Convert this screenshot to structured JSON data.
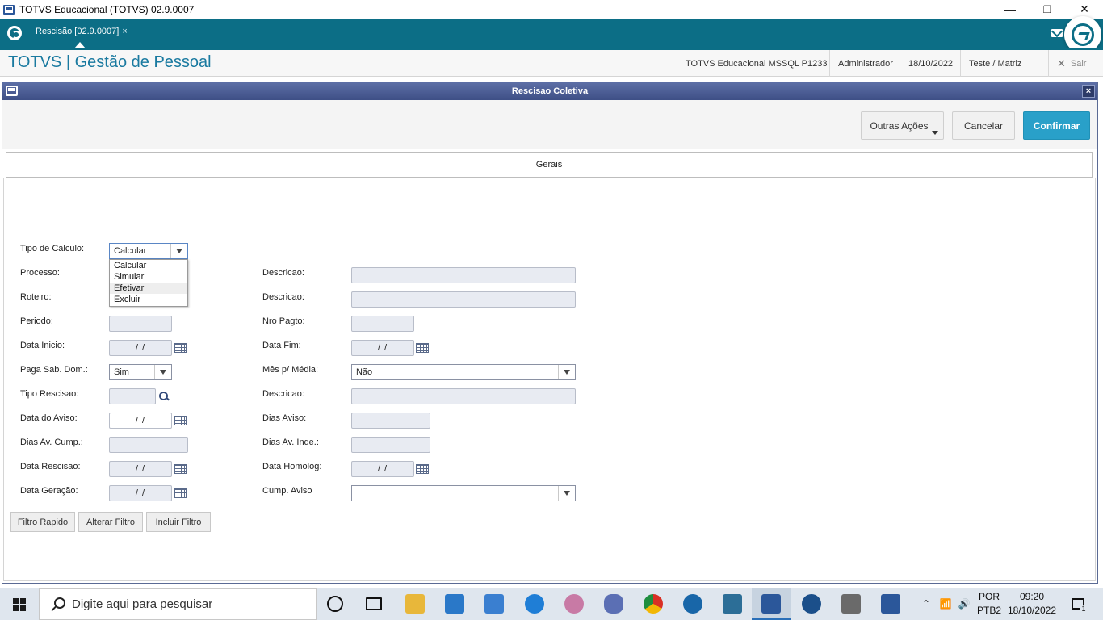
{
  "window": {
    "title": "TOTVS Educacional (TOTVS) 02.9.0007",
    "minimize": "—",
    "restore": "❐",
    "close": "✕"
  },
  "tabbar": {
    "tab_label": "Rescisão [02.9.0007]",
    "tab_close": "×"
  },
  "header": {
    "brand": "TOTVS | Gestão de Pessoal",
    "database": "TOTVS Educacional MSSQL P1233",
    "user": "Administrador",
    "date": "18/10/2022",
    "branch": "Teste / Matriz",
    "exit_label": "Sair"
  },
  "dialog": {
    "title": "Rescisao Coletiva",
    "close": "×",
    "actions": {
      "other_actions": "Outras Ações",
      "cancel": "Cancelar",
      "confirm": "Confirmar"
    },
    "tab": "Gerais"
  },
  "form": {
    "tipo_calculo": {
      "label": "Tipo de Calculo:",
      "value": "Calcular",
      "options": [
        "Calcular",
        "Simular",
        "Efetivar",
        "Excluir"
      ],
      "highlighted": "Efetivar"
    },
    "processo": {
      "label": "Processo:"
    },
    "descricao1": {
      "label": "Descricao:"
    },
    "roteiro": {
      "label": "Roteiro:"
    },
    "descricao2": {
      "label": "Descricao:"
    },
    "periodo": {
      "label": "Periodo:"
    },
    "nro_pagto": {
      "label": "Nro Pagto:"
    },
    "data_inicio": {
      "label": "Data Inicio:",
      "value": "/ /"
    },
    "data_fim": {
      "label": "Data Fim:",
      "value": "/ /"
    },
    "paga_sab_dom": {
      "label": "Paga Sab. Dom.:",
      "value": "Sim"
    },
    "mes_media": {
      "label": "Mês p/ Média:",
      "value": "Não"
    },
    "tipo_rescisao": {
      "label": "Tipo Rescisao:"
    },
    "descricao3": {
      "label": "Descricao:"
    },
    "data_aviso": {
      "label": "Data do Aviso:",
      "value": "/ /"
    },
    "dias_aviso": {
      "label": "Dias Aviso:"
    },
    "dias_av_cump": {
      "label": "Dias Av. Cump.:"
    },
    "dias_av_inde": {
      "label": "Dias Av. Inde.:"
    },
    "data_rescisao": {
      "label": "Data Rescisao:",
      "value": "/ /"
    },
    "data_homolog": {
      "label": "Data Homolog:",
      "value": "/ /"
    },
    "data_geracao": {
      "label": "Data Geração:",
      "value": "/ /"
    },
    "cump_aviso": {
      "label": "Cump. Aviso",
      "value": ""
    }
  },
  "filters": {
    "quick": "Filtro Rapido",
    "change": "Alterar Filtro",
    "include": "Incluir Filtro"
  },
  "taskbar": {
    "search_placeholder": "Digite aqui para pesquisar",
    "language_line1": "POR",
    "language_line2": "PTB2",
    "time": "09:20",
    "date": "18/10/2022",
    "notification_count": "1"
  },
  "colors": {
    "accent": "#0c6e86",
    "brand_text": "#1a7aa0",
    "primary_button": "#29a0c9",
    "dialog_title": "#4a5b92"
  }
}
